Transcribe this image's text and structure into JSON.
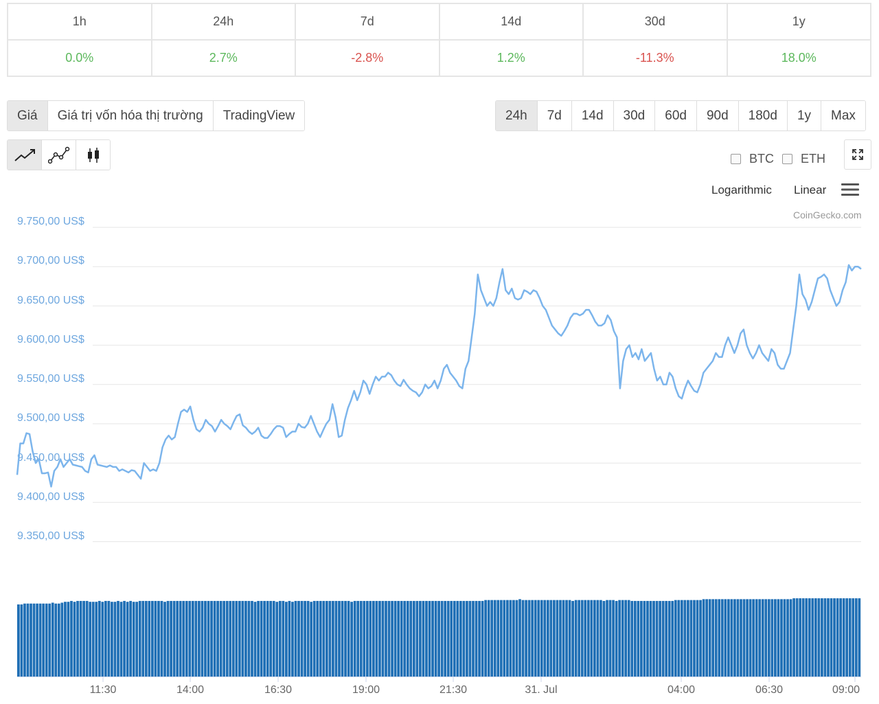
{
  "performance": {
    "headers": [
      "1h",
      "24h",
      "7d",
      "14d",
      "30d",
      "1y"
    ],
    "values": [
      "0.0%",
      "2.7%",
      "-2.8%",
      "1.2%",
      "-11.3%",
      "18.0%"
    ]
  },
  "chart_tabs": [
    "Giá",
    "Giá trị vốn hóa thị trường",
    "TradingView"
  ],
  "ranges": [
    "24h",
    "7d",
    "14d",
    "30d",
    "60d",
    "90d",
    "180d",
    "1y",
    "Max"
  ],
  "chart_type_icons": [
    "line-chart-icon",
    "line-points-icon",
    "candlestick-icon"
  ],
  "compare": [
    "BTC",
    "ETH"
  ],
  "scale_options": [
    "Logarithmic",
    "Linear"
  ],
  "credit": "CoinGecko.com",
  "colors": {
    "up": "#5cb85c",
    "down": "#d9534f",
    "line": "#7cb5ec",
    "volume": "#1f6fb5"
  },
  "chart_data": {
    "type": "line",
    "title": "",
    "y_tick_labels": [
      "9.750,00 US$",
      "9.700,00 US$",
      "9.650,00 US$",
      "9.600,00 US$",
      "9.550,00 US$",
      "9.500,00 US$",
      "9.450,00 US$",
      "9.400,00 US$",
      "9.350,00 US$"
    ],
    "ylim": [
      9335,
      9755
    ],
    "x_tick_labels": [
      "11:30",
      "14:00",
      "16:30",
      "19:00",
      "21:30",
      "31. Jul",
      "04:00",
      "06:30",
      "09:00"
    ],
    "series": [
      {
        "values": [
          9435,
          9475,
          9475,
          9488,
          9487,
          9465,
          9450,
          9455,
          9437,
          9437,
          9438,
          9420,
          9440,
          9445,
          9455,
          9445,
          9450,
          9455,
          9448,
          9447,
          9446,
          9445,
          9440,
          9438,
          9455,
          9460,
          9448,
          9447,
          9446,
          9445,
          9447,
          9445,
          9445,
          9440,
          9442,
          9440,
          9438,
          9441,
          9440,
          9435,
          9430,
          9450,
          9445,
          9440,
          9442,
          9440,
          9450,
          9470,
          9480,
          9485,
          9480,
          9483,
          9500,
          9515,
          9518,
          9515,
          9522,
          9505,
          9493,
          9490,
          9495,
          9505,
          9500,
          9497,
          9490,
          9497,
          9505,
          9500,
          9497,
          9493,
          9502,
          9510,
          9512,
          9498,
          9495,
          9490,
          9487,
          9490,
          9495,
          9485,
          9482,
          9482,
          9487,
          9493,
          9497,
          9497,
          9495,
          9483,
          9487,
          9490,
          9490,
          9500,
          9496,
          9495,
          9500,
          9510,
          9500,
          9490,
          9483,
          9492,
          9500,
          9505,
          9525,
          9508,
          9483,
          9485,
          9505,
          9520,
          9530,
          9542,
          9530,
          9540,
          9555,
          9550,
          9538,
          9550,
          9560,
          9555,
          9560,
          9560,
          9565,
          9562,
          9555,
          9550,
          9548,
          9556,
          9550,
          9545,
          9542,
          9540,
          9535,
          9540,
          9550,
          9545,
          9548,
          9555,
          9545,
          9555,
          9570,
          9575,
          9565,
          9560,
          9555,
          9548,
          9545,
          9570,
          9580,
          9610,
          9640,
          9690,
          9670,
          9660,
          9650,
          9655,
          9650,
          9660,
          9680,
          9697,
          9670,
          9665,
          9672,
          9660,
          9658,
          9660,
          9670,
          9668,
          9665,
          9670,
          9668,
          9660,
          9650,
          9645,
          9635,
          9625,
          9620,
          9615,
          9612,
          9618,
          9625,
          9635,
          9640,
          9640,
          9638,
          9640,
          9645,
          9645,
          9638,
          9630,
          9625,
          9625,
          9628,
          9638,
          9632,
          9618,
          9610,
          9545,
          9580,
          9595,
          9600,
          9585,
          9590,
          9582,
          9595,
          9580,
          9585,
          9590,
          9570,
          9555,
          9560,
          9550,
          9550,
          9565,
          9560,
          9545,
          9535,
          9532,
          9545,
          9555,
          9548,
          9542,
          9540,
          9550,
          9565,
          9570,
          9575,
          9580,
          9590,
          9585,
          9585,
          9600,
          9610,
          9600,
          9590,
          9600,
          9615,
          9620,
          9600,
          9590,
          9583,
          9590,
          9600,
          9590,
          9585,
          9580,
          9595,
          9590,
          9575,
          9570,
          9570,
          9580,
          9590,
          9620,
          9650,
          9690,
          9665,
          9658,
          9645,
          9655,
          9670,
          9685,
          9687,
          9690,
          9685,
          9670,
          9660,
          9650,
          9655,
          9670,
          9680,
          9702,
          9695,
          9700,
          9700,
          9697
        ]
      }
    ],
    "volume": [
      0.82,
      0.82,
      0.83,
      0.83,
      0.83,
      0.83,
      0.83,
      0.83,
      0.83,
      0.83,
      0.83,
      0.84,
      0.83,
      0.83,
      0.84,
      0.85,
      0.85,
      0.86,
      0.85,
      0.86,
      0.86,
      0.86,
      0.86,
      0.85,
      0.85,
      0.85,
      0.86,
      0.85,
      0.86,
      0.86,
      0.85,
      0.85,
      0.86,
      0.85,
      0.86,
      0.85,
      0.86,
      0.85,
      0.85,
      0.86,
      0.86,
      0.86,
      0.86,
      0.86,
      0.86,
      0.86,
      0.86,
      0.85,
      0.86,
      0.86,
      0.86,
      0.86,
      0.86,
      0.86,
      0.86,
      0.86,
      0.86,
      0.86,
      0.86,
      0.86,
      0.86,
      0.86,
      0.86,
      0.86,
      0.86,
      0.86,
      0.86,
      0.86,
      0.86,
      0.86,
      0.86,
      0.86,
      0.86,
      0.86,
      0.86,
      0.86,
      0.85,
      0.86,
      0.86,
      0.86,
      0.86,
      0.86,
      0.86,
      0.85,
      0.86,
      0.86,
      0.85,
      0.86,
      0.85,
      0.86,
      0.86,
      0.86,
      0.86,
      0.86,
      0.85,
      0.86,
      0.86,
      0.86,
      0.86,
      0.86,
      0.86,
      0.86,
      0.86,
      0.86,
      0.86,
      0.86,
      0.86,
      0.85,
      0.86,
      0.86,
      0.86,
      0.86,
      0.86,
      0.86,
      0.86,
      0.86,
      0.86,
      0.86,
      0.86,
      0.86,
      0.86,
      0.86,
      0.86,
      0.86,
      0.86,
      0.86,
      0.86,
      0.86,
      0.86,
      0.86,
      0.86,
      0.86,
      0.86,
      0.86,
      0.86,
      0.86,
      0.86,
      0.86,
      0.86,
      0.86,
      0.86,
      0.86,
      0.86,
      0.86,
      0.86,
      0.86,
      0.86,
      0.86,
      0.86,
      0.86,
      0.87,
      0.87,
      0.87,
      0.87,
      0.87,
      0.87,
      0.87,
      0.87,
      0.87,
      0.87,
      0.87,
      0.88,
      0.87,
      0.87,
      0.87,
      0.87,
      0.87,
      0.87,
      0.87,
      0.87,
      0.87,
      0.87,
      0.87,
      0.87,
      0.87,
      0.87,
      0.87,
      0.87,
      0.86,
      0.87,
      0.87,
      0.87,
      0.87,
      0.87,
      0.87,
      0.87,
      0.87,
      0.87,
      0.86,
      0.87,
      0.87,
      0.87,
      0.86,
      0.87,
      0.87,
      0.87,
      0.87,
      0.86,
      0.86,
      0.86,
      0.86,
      0.86,
      0.86,
      0.86,
      0.86,
      0.86,
      0.86,
      0.86,
      0.86,
      0.86,
      0.86,
      0.87,
      0.87,
      0.87,
      0.87,
      0.87,
      0.87,
      0.87,
      0.87,
      0.87,
      0.88,
      0.88,
      0.88,
      0.88,
      0.88,
      0.88,
      0.88,
      0.88,
      0.88,
      0.88,
      0.88,
      0.88,
      0.88,
      0.88,
      0.88,
      0.88,
      0.88,
      0.88,
      0.88,
      0.88,
      0.88,
      0.88,
      0.88,
      0.88,
      0.88,
      0.88,
      0.88,
      0.88,
      0.88,
      0.89,
      0.89,
      0.89,
      0.89,
      0.89,
      0.89,
      0.89,
      0.89,
      0.89,
      0.89,
      0.89,
      0.89,
      0.89,
      0.89,
      0.89,
      0.89,
      0.89,
      0.89,
      0.89,
      0.89,
      0.89,
      0.89
    ]
  }
}
